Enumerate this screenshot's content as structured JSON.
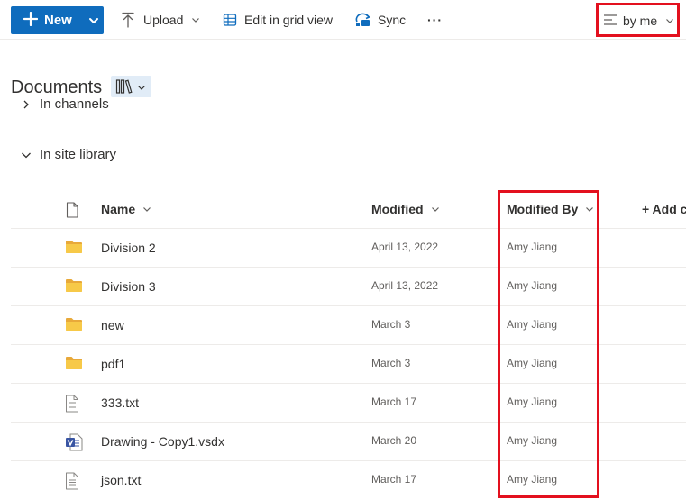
{
  "toolbar": {
    "new_label": "New",
    "upload_label": "Upload",
    "grid_label": "Edit in grid view",
    "sync_label": "Sync",
    "more_label": "···",
    "view_label": "by me"
  },
  "library": {
    "title": "Documents"
  },
  "groups": {
    "channels": "In channels",
    "site": "In site library"
  },
  "columns": {
    "name": "Name",
    "modified": "Modified",
    "modified_by": "Modified By",
    "add_column": "+ Add c"
  },
  "rows": [
    {
      "type": "folder",
      "icon": "folder-icon",
      "name": "Division 2",
      "modified": "April 13, 2022",
      "modified_by": "Amy Jiang"
    },
    {
      "type": "folder",
      "icon": "folder-icon",
      "name": "Division 3",
      "modified": "April 13, 2022",
      "modified_by": "Amy Jiang"
    },
    {
      "type": "folder",
      "icon": "folder-icon",
      "name": "new",
      "modified": "March 3",
      "modified_by": "Amy Jiang"
    },
    {
      "type": "folder",
      "icon": "folder-icon",
      "name": "pdf1",
      "modified": "March 3",
      "modified_by": "Amy Jiang"
    },
    {
      "type": "txt",
      "icon": "text-file-icon",
      "name": "333.txt",
      "modified": "March 17",
      "modified_by": "Amy Jiang"
    },
    {
      "type": "vsdx",
      "icon": "visio-file-icon",
      "name": "Drawing - Copy1.vsdx",
      "modified": "March 20",
      "modified_by": "Amy Jiang"
    },
    {
      "type": "txt",
      "icon": "text-file-icon",
      "name": "json.txt",
      "modified": "March 17",
      "modified_by": "Amy Jiang"
    }
  ],
  "colors": {
    "brand": "#0f6cbd",
    "highlight": "#e3101e",
    "folder": "#f3c33a"
  }
}
